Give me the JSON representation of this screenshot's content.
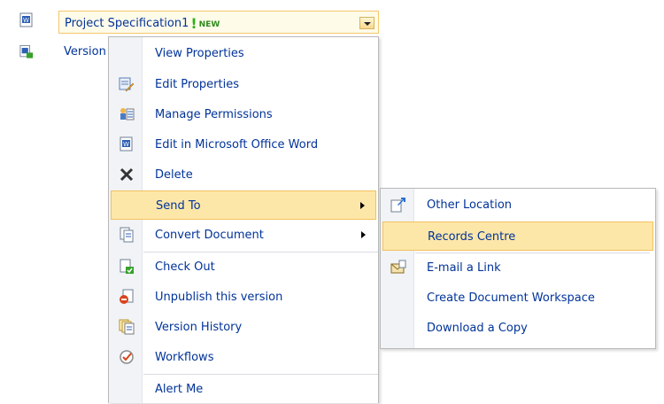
{
  "document": {
    "title": "Project Specification1",
    "new_badge": "NEW",
    "second_item_label": "Version"
  },
  "main_menu": {
    "items": [
      {
        "label": "View Properties"
      },
      {
        "label": "Edit Properties"
      },
      {
        "label": "Manage Permissions"
      },
      {
        "label": "Edit in Microsoft Office Word"
      },
      {
        "label": "Delete"
      },
      {
        "label": "Send To"
      },
      {
        "label": "Convert Document"
      },
      {
        "label": "Check Out"
      },
      {
        "label": "Unpublish this version"
      },
      {
        "label": "Version History"
      },
      {
        "label": "Workflows"
      },
      {
        "label": "Alert Me"
      }
    ]
  },
  "send_to_menu": {
    "items": [
      {
        "label": "Other Location"
      },
      {
        "label": "Records Centre"
      },
      {
        "label": "E-mail a Link"
      },
      {
        "label": "Create Document Workspace"
      },
      {
        "label": "Download a Copy"
      }
    ]
  },
  "colors": {
    "highlight": "#fde7a8",
    "highlight_border": "#f1c15f",
    "link_text": "#003399"
  }
}
